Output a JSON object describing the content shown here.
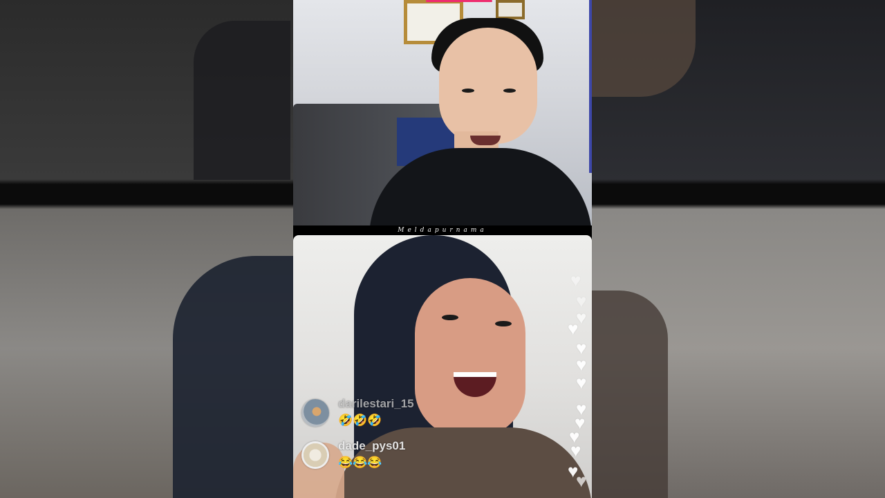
{
  "stream": {
    "watermark": "Meldapurnama"
  },
  "comments": [
    {
      "username": "darilestari_15",
      "text": "🤣🤣🤣"
    },
    {
      "username": "dade_pys01",
      "text": "😂😂😂"
    }
  ],
  "colors": {
    "accent": "#ee2c6f",
    "heart": "#ffffff"
  },
  "icons": {
    "reaction": "heart-icon"
  }
}
